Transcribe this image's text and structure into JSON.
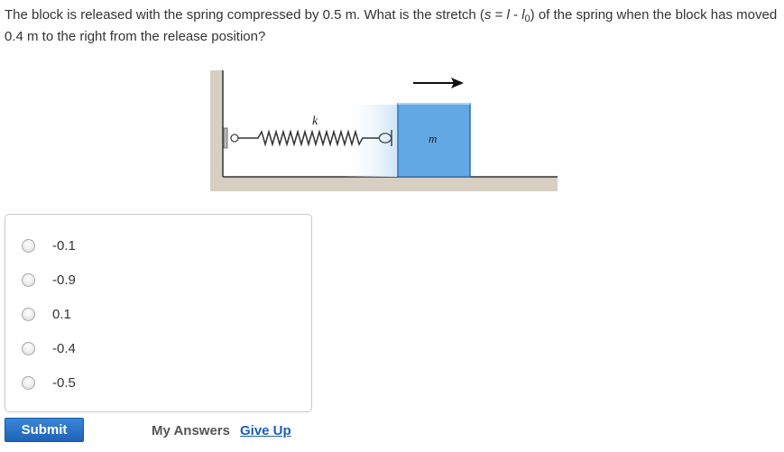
{
  "question": {
    "part1": "The block is released with the spring compressed by 0.5 m. What is the stretch (",
    "s": "s",
    "eq": " = ",
    "l": "l",
    "minus": " - ",
    "l0": "l",
    "sub0": "0",
    "part2": ") of the spring when the block has moved 0.4 m to the right from the release position?"
  },
  "figure": {
    "spring_label": "k",
    "block_label": "m",
    "block_color": "#62a8e5",
    "block_border": "#2f6fb0"
  },
  "choices": [
    {
      "label": "-0.1"
    },
    {
      "label": "-0.9"
    },
    {
      "label": "0.1"
    },
    {
      "label": "-0.4"
    },
    {
      "label": "-0.5"
    }
  ],
  "actions": {
    "submit": "Submit",
    "my_answers": "My Answers",
    "give_up": "Give Up"
  }
}
